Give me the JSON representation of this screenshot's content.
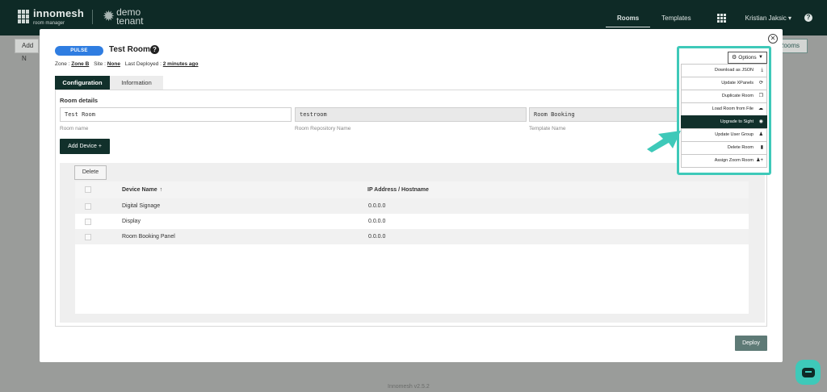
{
  "nav": {
    "logo_text": "innomesh",
    "logo_sub": "room manager",
    "tenant_line1": "demo",
    "tenant_line2": "tenant",
    "rooms": "Rooms",
    "templates": "Templates",
    "user": "Kristian Jaksic ▾",
    "help": "?"
  },
  "background": {
    "add_btn": "Add N",
    "rooms_btn": "Rooms",
    "footer": "Innomesh v2.5.2"
  },
  "modal": {
    "close": "✕",
    "badge": "PULSE",
    "title": "Test Room",
    "title_help": "?",
    "meta": {
      "zone_label": "Zone :",
      "zone_value": "Zone B",
      "site_label": "Site :",
      "site_value": "None",
      "deployed_label": "Last Deployed :",
      "deployed_value": "2 minutes ago"
    },
    "tabs": [
      {
        "label": "Configuration"
      },
      {
        "label": "Information"
      }
    ],
    "room_details": {
      "title": "Room details",
      "room_name": "Test Room",
      "room_name_label": "Room name",
      "repo_name": "testroom",
      "repo_name_label": "Room Repository Name",
      "template_name": "Room Booking",
      "template_name_label": "Template Name"
    },
    "add_device": "Add Device +",
    "delete": "Delete",
    "table": {
      "columns": [
        "Device Name",
        "IP Address / Hostname"
      ],
      "sort_arrow": "↑",
      "rows": [
        {
          "name": "Digital Signage",
          "ip": "0.0.0.0"
        },
        {
          "name": "Display",
          "ip": "0.0.0.0"
        },
        {
          "name": "Room Booking Panel",
          "ip": "0.0.0.0"
        }
      ]
    },
    "deploy": "Deploy"
  },
  "options": {
    "button": "Options",
    "items": [
      {
        "label": "Download as JSON",
        "icon": "download-icon",
        "glyph": "⤓"
      },
      {
        "label": "Update XPanels",
        "icon": "refresh-icon",
        "glyph": "⟳"
      },
      {
        "label": "Duplicate Room",
        "icon": "copy-icon",
        "glyph": "❐"
      },
      {
        "label": "Load Room from File",
        "icon": "cloud-upload-icon",
        "glyph": "☁"
      },
      {
        "label": "Upgrade to Sight",
        "icon": "eye-icon",
        "glyph": "◉"
      },
      {
        "label": "Update User Group",
        "icon": "user-icon",
        "glyph": "♟"
      },
      {
        "label": "Delete Room",
        "icon": "trash-icon",
        "glyph": "▮"
      },
      {
        "label": "Assign Zoom Room",
        "icon": "user-plus-icon",
        "glyph": "♟+"
      }
    ],
    "selected_index": 4
  },
  "colors": {
    "nav_bg": "#0e2a26",
    "accent_teal": "#3ec9b9",
    "primary_dark": "#11302b",
    "badge_blue": "#2f7de1"
  }
}
